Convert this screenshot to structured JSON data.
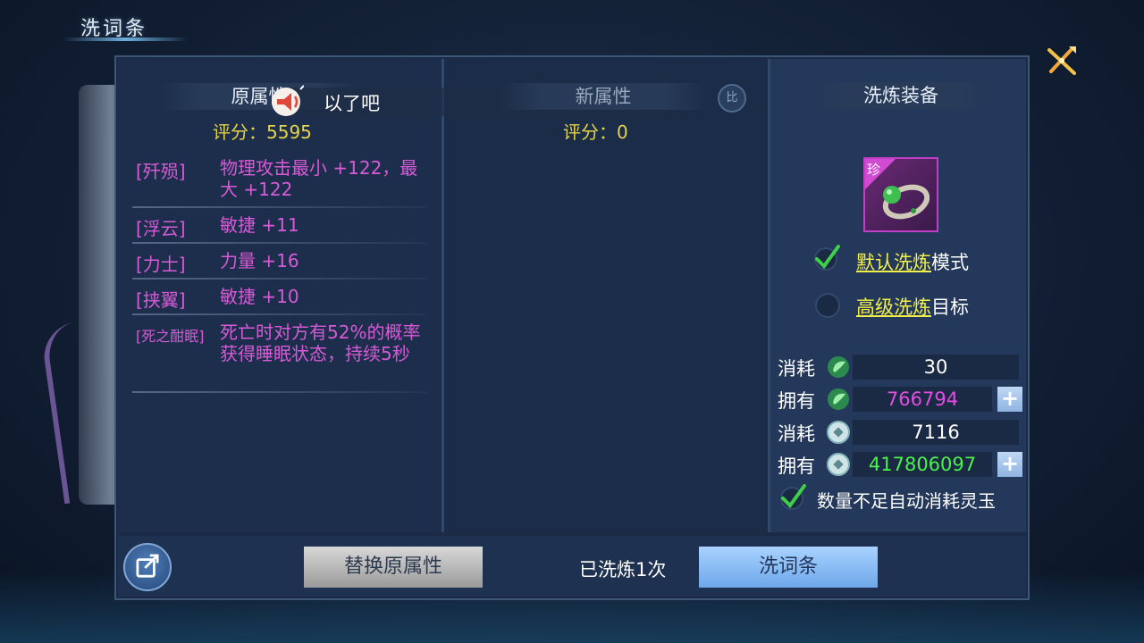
{
  "window": {
    "title": "洗词条"
  },
  "left_panel": {
    "header": "原属性",
    "score_label": "评分：",
    "score_value": "5595",
    "attributes": [
      {
        "tag": "[歼殒]",
        "value": "物理攻击最小 +122，最大 +122"
      },
      {
        "tag": "[浮云]",
        "value": "敏捷 +11"
      },
      {
        "tag": "[力士]",
        "value": "力量 +16"
      },
      {
        "tag": "[挟翼]",
        "value": "敏捷 +10"
      },
      {
        "tag": "[死之酣眠]",
        "value": "死亡时对方有52%的概率获得睡眠状态，持续5秒"
      }
    ]
  },
  "notice": {
    "text": "以了吧"
  },
  "mid_panel": {
    "header": "新属性",
    "score_label": "评分：",
    "score_value": "0",
    "compare_label": "比"
  },
  "right_panel": {
    "header": "洗炼装备",
    "item": {
      "rarity_label": "珍",
      "icon": "jade-ring-icon"
    },
    "mode_default": {
      "link": "默认洗炼",
      "suffix": "模式",
      "checked": true
    },
    "mode_advanced": {
      "link": "高级洗炼",
      "suffix": "目标",
      "checked": false
    },
    "resources": [
      {
        "label": "消耗",
        "icon": "jade-leaf-icon",
        "value": "30",
        "color": "#ffffff"
      },
      {
        "label": "拥有",
        "icon": "jade-leaf-icon",
        "value": "766794",
        "color": "#e04fe0"
      },
      {
        "label": "消耗",
        "icon": "coin-icon",
        "value": "7116",
        "color": "#ffffff"
      },
      {
        "label": "拥有",
        "icon": "coin-icon",
        "value": "417806097",
        "color": "#4cf04c"
      }
    ],
    "plus_label": "+",
    "auto_consume": {
      "text": "数量不足自动消耗灵玉",
      "checked": true
    }
  },
  "bottom": {
    "replace_button": "替换原属性",
    "wash_count": "已洗炼1次",
    "wash_button": "洗词条"
  },
  "colors": {
    "attribute": "#d75ad6",
    "score": "#e5d34a",
    "link": "#f2ef4a"
  }
}
